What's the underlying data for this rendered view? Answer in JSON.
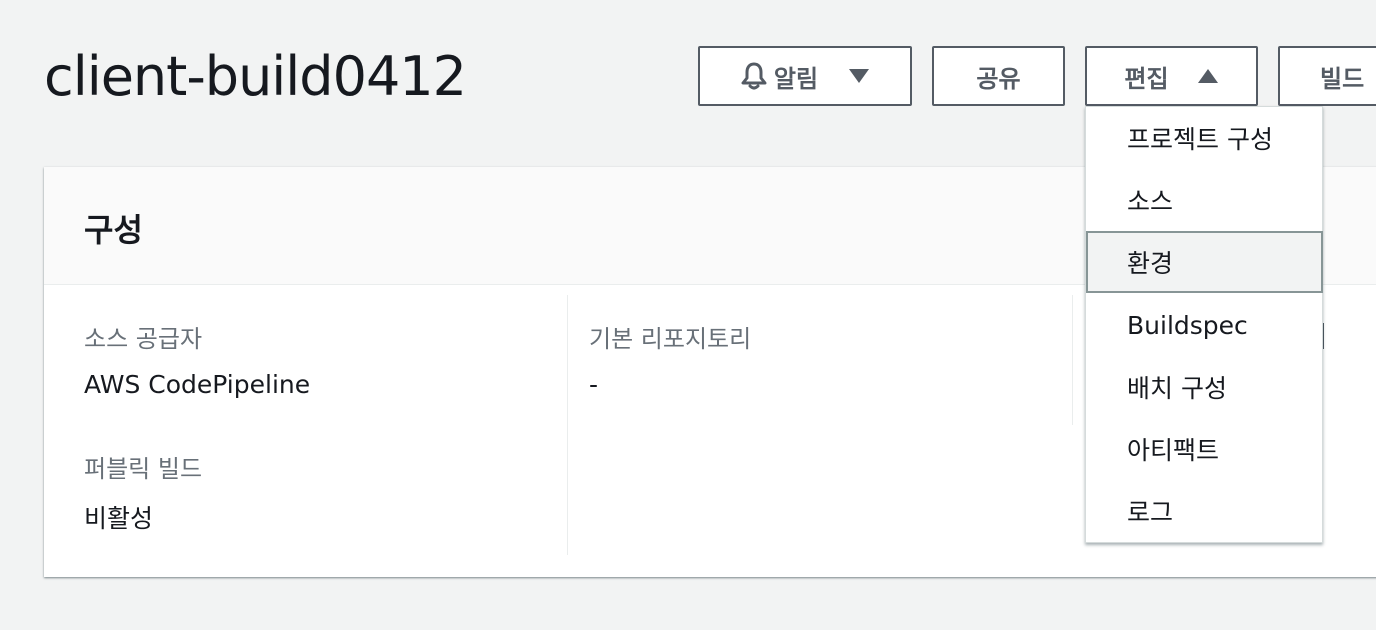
{
  "header": {
    "title": "client-build0412",
    "buttons": {
      "notify_label": "알림",
      "share_label": "공유",
      "edit_label": "편집",
      "build_label": "빌드"
    }
  },
  "panel": {
    "title": "구성",
    "fields": [
      {
        "label": "소스 공급자",
        "value": "AWS CodePipeline"
      },
      {
        "label": "퍼블릭 빌드",
        "value": "비활성"
      },
      {
        "label": "기본 리포지토리",
        "value": "-"
      }
    ]
  },
  "edit_menu": {
    "items": [
      {
        "label": "프로젝트 구성"
      },
      {
        "label": "소스"
      },
      {
        "label": "환경",
        "highlighted": true
      },
      {
        "label": "Buildspec"
      },
      {
        "label": "배치 구성"
      },
      {
        "label": "아티팩트"
      },
      {
        "label": "로그"
      }
    ]
  },
  "icons": {
    "notify": "bell-icon",
    "notify_caret": "caret-down-icon",
    "edit_caret": "caret-up-icon"
  },
  "colors": {
    "background": "#f2f3f3",
    "button_border": "#545b64",
    "label_gray": "#687078",
    "text": "#16191f",
    "highlight_border": "#879596"
  }
}
